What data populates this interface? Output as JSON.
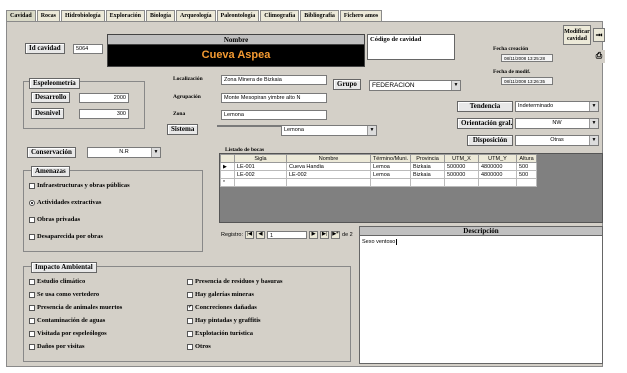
{
  "tabs": [
    "Cavidad",
    "Rocas",
    "Hidrobiología",
    "Exploración",
    "Biología",
    "Arqueología",
    "Paleontología",
    "Climografía",
    "Bibliografía",
    "Fichero amos"
  ],
  "toolbar": {
    "modify_label": "Modificar cavidad",
    "exit_icon": "exit-door-icon",
    "print_icon": "printer-icon"
  },
  "header": {
    "id_label": "Id cavidad",
    "id_value": "5064",
    "name_label": "Nombre",
    "name_value": "Cueva Aspea",
    "code_label": "Código de cavidad",
    "code_value": "",
    "created_label": "Fecha creación",
    "created_value": "08/11/2008 13:25:28",
    "modified_label": "Fecha de modif.",
    "modified_value": "08/11/2008 13:26:35"
  },
  "espeleometria": {
    "title": "Espeleometría",
    "desarrollo_label": "Desarrollo",
    "desarrollo_value": "2000",
    "desnivel_label": "Desnivel",
    "desnivel_value": "300"
  },
  "location": {
    "localizacion_label": "Localización",
    "localizacion_value": "Zona Minera de Bizkaia",
    "agrupacion_label": "Agrupación",
    "agrupacion_value": "Monte Mesopiran yimbre alto N",
    "zona_label": "Zona",
    "zona_value": "Lemona",
    "sistema_label": "Sistema",
    "sistema_value": "Lemona",
    "grupo_label": "Grupo",
    "grupo_value": "FEDERACION"
  },
  "right": {
    "tendencia_label": "Tendencia",
    "tendencia_value": "Indeterminado",
    "orientacion_label": "Orientación gral.",
    "orientacion_value": "NW",
    "disposicion_label": "Disposición",
    "disposicion_value": "Otras"
  },
  "conservacion": {
    "label": "Conservación",
    "value": "N.R",
    "amenazas_title": "Amenazas",
    "options": [
      {
        "label": "Infraestructuras y obras públicas",
        "checked": false
      },
      {
        "label": "Actividades extractivas",
        "checked": true
      },
      {
        "label": "Obras privadas",
        "checked": false
      },
      {
        "label": "Desaparecida por obras",
        "checked": false
      }
    ]
  },
  "bocas": {
    "title": "Listado de bocas",
    "columns": [
      "Sigla",
      "Nombre",
      "Término/Muni.",
      "Provincia",
      "UTM_X",
      "UTM_Y",
      "Altura"
    ],
    "rows": [
      [
        "LE-001",
        "Cueva Handia",
        "Lemoa",
        "Bizkaia",
        "500000",
        "4800000",
        "500"
      ],
      [
        "LE-002",
        "LE-002",
        "Lemoa",
        "Bizkaia",
        "500000",
        "4800000",
        "500"
      ]
    ],
    "nav_label": "Registro:",
    "nav_current": "1",
    "nav_total": "de 2"
  },
  "impacto": {
    "title": "Impacto Ambiental",
    "left": [
      {
        "label": "Estudio climático",
        "checked": false
      },
      {
        "label": "Se usa como vertedero",
        "checked": false
      },
      {
        "label": "Presencia de animales muertos",
        "checked": false
      },
      {
        "label": "Contaminación de aguas",
        "checked": false
      },
      {
        "label": "Visitada por espeleólogos",
        "checked": false
      },
      {
        "label": "Daños por visitas",
        "checked": false
      }
    ],
    "right": [
      {
        "label": "Presencia de residuos y basuras",
        "checked": false
      },
      {
        "label": "Hay galerías mineras",
        "checked": false
      },
      {
        "label": "Concreciones dañadas",
        "checked": true
      },
      {
        "label": "Hay pintadas y graffitis",
        "checked": false
      },
      {
        "label": "Explotación turística",
        "checked": false
      },
      {
        "label": "Otros",
        "checked": false
      }
    ]
  },
  "descripcion": {
    "title": "Descripción",
    "value": "Sexo ventoso"
  }
}
